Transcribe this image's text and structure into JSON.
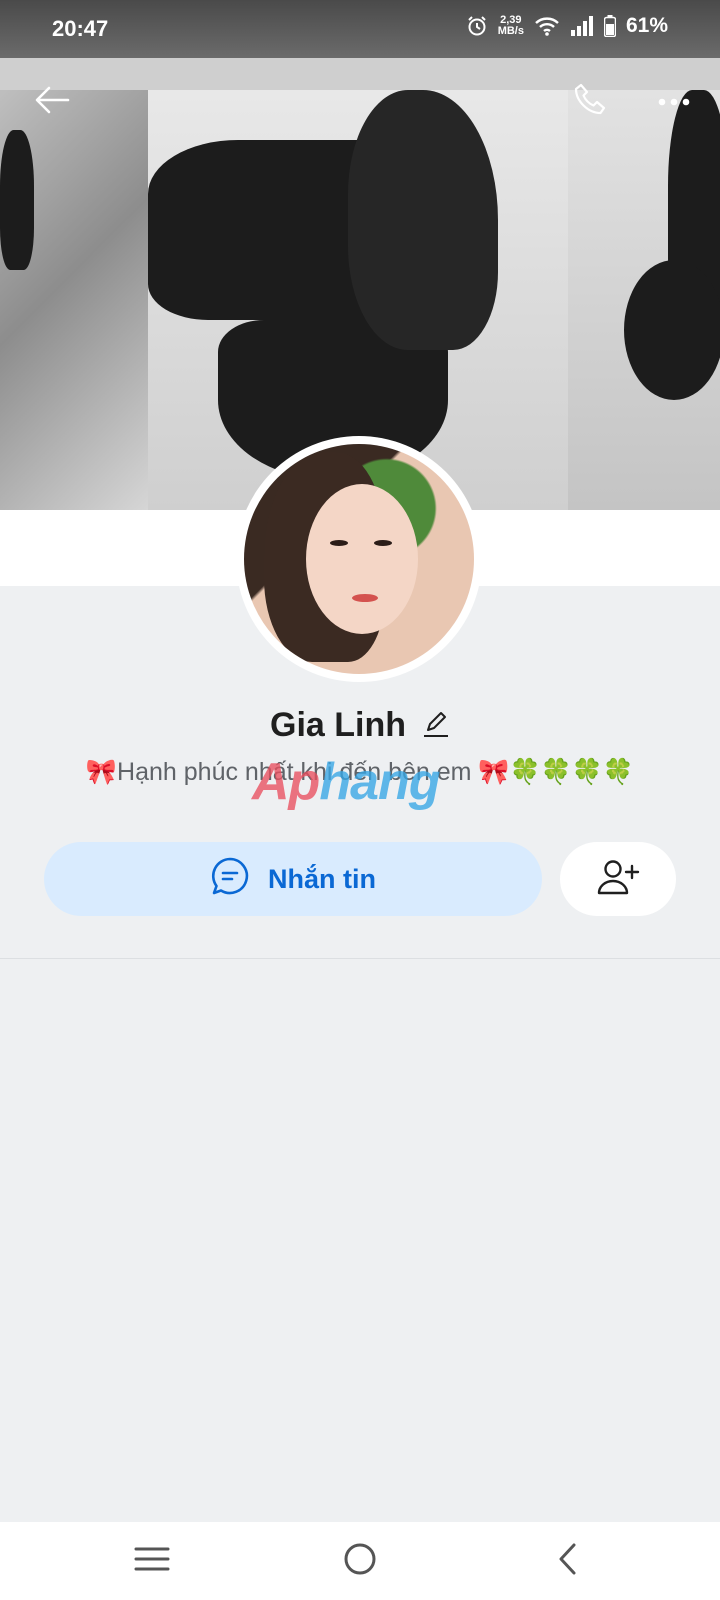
{
  "status_bar": {
    "time": "20:47",
    "net_speed_value": "2,39",
    "net_speed_unit": "MB/s",
    "battery": "61%",
    "icons": [
      "alarm-icon",
      "wifi-icon",
      "signal-icon",
      "battery-icon"
    ]
  },
  "header": {
    "icons": [
      "back-arrow-icon",
      "phone-icon",
      "more-icon"
    ]
  },
  "profile": {
    "name": "Gia Linh",
    "status": "🎀Hạnh phúc nhất khi đến bên em 🎀🍀🍀🍀🍀",
    "watermark_part1": "Ap",
    "watermark_part2": "hang"
  },
  "actions": {
    "message_label": "Nhắn tin",
    "message_icon": "chat-bubble-icon",
    "add_friend_icon": "add-user-icon"
  },
  "colors": {
    "accent": "#0a68d4",
    "message_button_bg": "#d9ebfe",
    "page_bg": "#eef0f2"
  },
  "nav_bar": {
    "icons": [
      "menu-icon",
      "home-icon",
      "back-icon"
    ]
  }
}
